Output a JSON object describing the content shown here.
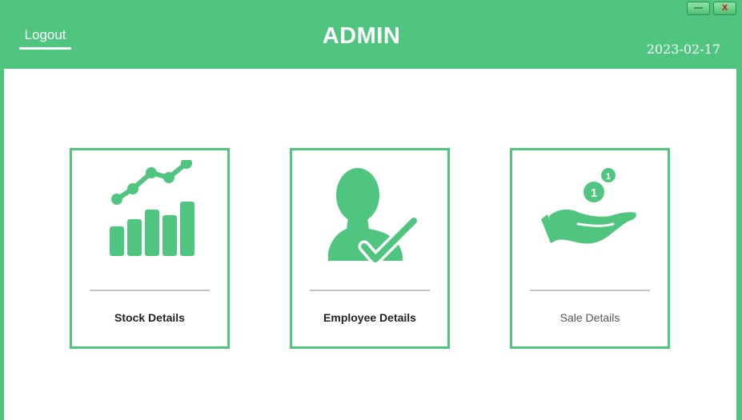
{
  "header": {
    "logout_label": "Logout",
    "title": "ADMIN",
    "date": "2023-02-17"
  },
  "window_controls": {
    "minimize_label": "—",
    "close_label": "X"
  },
  "cards": [
    {
      "label": "Stock Details",
      "icon": "growth-chart-icon"
    },
    {
      "label": "Employee Details",
      "icon": "verified-user-icon"
    },
    {
      "label": "Sale Details",
      "icon": "hand-coins-icon"
    }
  ],
  "colors": {
    "accent": "#50c57f",
    "background": "#ffffff",
    "divider": "#c4c4c4"
  }
}
